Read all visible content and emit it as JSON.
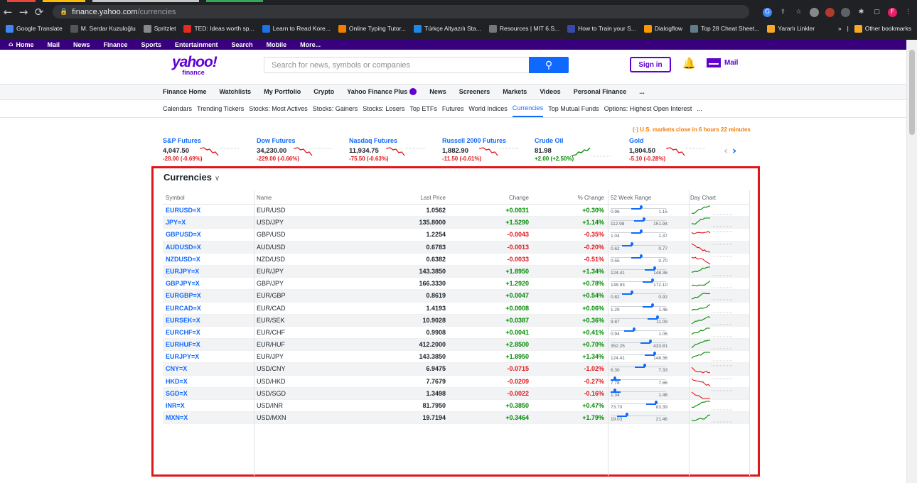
{
  "browser": {
    "url_host": "finance.yahoo.com",
    "url_path": "/currencies",
    "bookmarks": [
      {
        "label": "Google Translate",
        "color": "#4285f4"
      },
      {
        "label": "M. Serdar Kuzuloğlu",
        "color": "#555555"
      },
      {
        "label": "Spritzlet",
        "color": "#888888"
      },
      {
        "label": "TED: Ideas worth sp...",
        "color": "#e62b1e"
      },
      {
        "label": "Learn to Read Kore...",
        "color": "#1a73e8"
      },
      {
        "label": "Online Typing Tutor...",
        "color": "#f57c00"
      },
      {
        "label": "Türkçe Altyazılı Sta...",
        "color": "#1e88e5"
      },
      {
        "label": "Resources | MIT 6.S...",
        "color": "#777777"
      },
      {
        "label": "How to Train your S...",
        "color": "#3949ab"
      },
      {
        "label": "Dialogflow",
        "color": "#ff9800"
      },
      {
        "label": "Top 28 Cheat Sheet...",
        "color": "#607d8b"
      },
      {
        "label": "Yararlı Linkler",
        "color": "#f9a825"
      }
    ],
    "other_bookmarks": "Other bookmarks",
    "overflow": "»"
  },
  "ynav": [
    "Home",
    "Mail",
    "News",
    "Finance",
    "Sports",
    "Entertainment",
    "Search",
    "Mobile",
    "More..."
  ],
  "header": {
    "logo_main": "yahoo!",
    "logo_sub": "finance",
    "search_placeholder": "Search for news, symbols or companies",
    "signin": "Sign in",
    "mail": "Mail"
  },
  "mainnav": [
    "Finance Home",
    "Watchlists",
    "My Portfolio",
    "Crypto",
    "Yahoo Finance Plus",
    "News",
    "Screeners",
    "Markets",
    "Videos",
    "Personal Finance",
    "..."
  ],
  "subnav": [
    "Calendars",
    "Trending Tickers",
    "Stocks: Most Actives",
    "Stocks: Gainers",
    "Stocks: Losers",
    "Top ETFs",
    "Futures",
    "World Indices",
    "Currencies",
    "Top Mutual Funds",
    "Options: Highest Open Interest",
    "..."
  ],
  "subnav_active": "Currencies",
  "market_note": "U.S. markets close in 6 hours 22 minutes",
  "tickers": [
    {
      "name": "S&P Futures",
      "price": "4,047.50",
      "change": "-28.00 (-0.69%)",
      "dir": "neg"
    },
    {
      "name": "Dow Futures",
      "price": "34,230.00",
      "change": "-229.00 (-0.66%)",
      "dir": "neg"
    },
    {
      "name": "Nasdaq Futures",
      "price": "11,934.75",
      "change": "-75.50 (-0.63%)",
      "dir": "neg"
    },
    {
      "name": "Russell 2000 Futures",
      "price": "1,882.90",
      "change": "-11.50 (-0.61%)",
      "dir": "neg"
    },
    {
      "name": "Crude Oil",
      "price": "81.98",
      "change": "+2.00 (+2.50%)",
      "dir": "pos"
    },
    {
      "name": "Gold",
      "price": "1,804.50",
      "change": "-5.10 (-0.28%)",
      "dir": "neg"
    }
  ],
  "currencies": {
    "title": "Currencies",
    "columns": [
      "Symbol",
      "Name",
      "Last Price",
      "Change",
      "% Change",
      "52 Week Range",
      "Day Chart"
    ],
    "rows": [
      {
        "symbol": "EURUSD=X",
        "name": "EUR/USD",
        "last": "1.0562",
        "change": "+0.0031",
        "pct": "+0.30%",
        "lo": "0.96",
        "hi": "1.15",
        "pos": 0.55
      },
      {
        "symbol": "JPY=X",
        "name": "USD/JPY",
        "last": "135.8000",
        "change": "+1.5290",
        "pct": "+1.14%",
        "lo": "112.98",
        "hi": "151.94",
        "pos": 0.6
      },
      {
        "symbol": "GBPUSD=X",
        "name": "GBP/USD",
        "last": "1.2254",
        "change": "-0.0043",
        "pct": "-0.35%",
        "lo": "1.04",
        "hi": "1.37",
        "pos": 0.55
      },
      {
        "symbol": "AUDUSD=X",
        "name": "AUD/USD",
        "last": "0.6783",
        "change": "-0.0013",
        "pct": "-0.20%",
        "lo": "0.62",
        "hi": "0.77",
        "pos": 0.38
      },
      {
        "symbol": "NZDUSD=X",
        "name": "NZD/USD",
        "last": "0.6382",
        "change": "-0.0033",
        "pct": "-0.51%",
        "lo": "0.55",
        "hi": "0.70",
        "pos": 0.55
      },
      {
        "symbol": "EURJPY=X",
        "name": "EUR/JPY",
        "last": "143.3850",
        "change": "+1.8950",
        "pct": "+1.34%",
        "lo": "124.41",
        "hi": "148.36",
        "pos": 0.8
      },
      {
        "symbol": "GBPJPY=X",
        "name": "GBP/JPY",
        "last": "166.3330",
        "change": "+1.2920",
        "pct": "+0.78%",
        "lo": "148.93",
        "hi": "172.10",
        "pos": 0.75
      },
      {
        "symbol": "EURGBP=X",
        "name": "EUR/GBP",
        "last": "0.8619",
        "change": "+0.0047",
        "pct": "+0.54%",
        "lo": "0.82",
        "hi": "0.92",
        "pos": 0.38
      },
      {
        "symbol": "EURCAD=X",
        "name": "EUR/CAD",
        "last": "1.4193",
        "change": "+0.0008",
        "pct": "+0.06%",
        "lo": "1.29",
        "hi": "1.46",
        "pos": 0.76
      },
      {
        "symbol": "EURSEK=X",
        "name": "EUR/SEK",
        "last": "10.9028",
        "change": "+0.0387",
        "pct": "+0.36%",
        "lo": "9.87",
        "hi": "11.09",
        "pos": 0.85
      },
      {
        "symbol": "EURCHF=X",
        "name": "EUR/CHF",
        "last": "0.9908",
        "change": "+0.0041",
        "pct": "+0.41%",
        "lo": "0.94",
        "hi": "1.06",
        "pos": 0.42
      },
      {
        "symbol": "EURHUF=X",
        "name": "EUR/HUF",
        "last": "412.2000",
        "change": "+2.8500",
        "pct": "+0.70%",
        "lo": "352.25",
        "hi": "433.81",
        "pos": 0.72
      },
      {
        "symbol": "EURJPY=X",
        "name": "EUR/JPY",
        "last": "143.3850",
        "change": "+1.8950",
        "pct": "+1.34%",
        "lo": "124.41",
        "hi": "148.36",
        "pos": 0.8
      },
      {
        "symbol": "CNY=X",
        "name": "USD/CNY",
        "last": "6.9475",
        "change": "-0.0715",
        "pct": "-1.02%",
        "lo": "6.30",
        "hi": "7.33",
        "pos": 0.62
      },
      {
        "symbol": "HKD=X",
        "name": "USD/HKD",
        "last": "7.7679",
        "change": "-0.0209",
        "pct": "-0.27%",
        "lo": "7.78",
        "hi": "7.86",
        "pos": 0.08
      },
      {
        "symbol": "SGD=X",
        "name": "USD/SGD",
        "last": "1.3498",
        "change": "-0.0022",
        "pct": "-0.16%",
        "lo": "1.34",
        "hi": "1.46",
        "pos": 0.08
      },
      {
        "symbol": "INR=X",
        "name": "USD/INR",
        "last": "81.7950",
        "change": "+0.3850",
        "pct": "+0.47%",
        "lo": "73.70",
        "hi": "83.39",
        "pos": 0.82
      },
      {
        "symbol": "MXN=X",
        "name": "USD/MXN",
        "last": "19.7194",
        "change": "+0.3464",
        "pct": "+1.79%",
        "lo": "19.03",
        "hi": "21.46",
        "pos": 0.3
      }
    ]
  },
  "colors": {
    "brand": "#6001d2",
    "nav_purple": "#39007d",
    "link_blue": "#0f69ff",
    "positive": "#008a00",
    "negative": "#e0161b",
    "highlight_box": "#e0161b"
  }
}
